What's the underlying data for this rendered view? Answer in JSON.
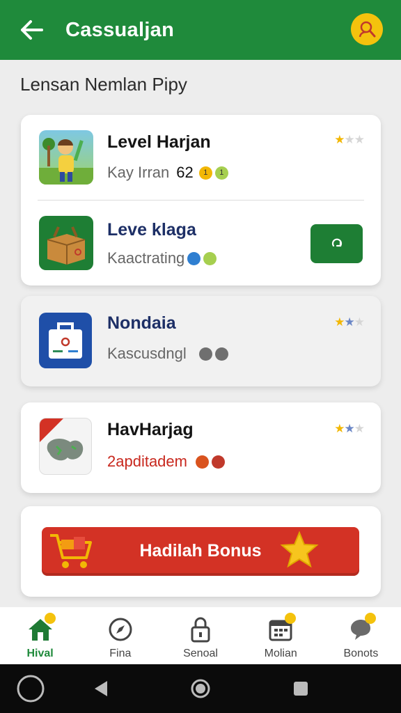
{
  "app_bar": {
    "title": "Cassualjan",
    "back_icon": "arrow-left-icon",
    "profile_icon": "user-icon"
  },
  "section_title": "Lensan Nemlan Pipy",
  "cards": [
    {
      "items": [
        {
          "name": "Level Harjan",
          "subtitle": "Kay Irran",
          "score": "62",
          "badges": [
            "1",
            "1"
          ],
          "rating": 1
        },
        {
          "name": "Leve klaga",
          "subtitle": "Kaactrating",
          "badges": [
            "",
            ""
          ],
          "action_icon": "refresh-icon"
        }
      ]
    },
    {
      "items": [
        {
          "name": "Nondaia",
          "subtitle": "Kascusdngl",
          "rating": 2
        }
      ]
    },
    {
      "items": [
        {
          "name": "HavHarjag",
          "subtitle": "2apditadem",
          "badges": [
            "",
            ""
          ],
          "rating": 2
        }
      ]
    }
  ],
  "bonus": {
    "label": "Hadilah Bonus",
    "left_icon": "shopping-cart-icon",
    "right_icon": "star-icon"
  },
  "bottom_nav": [
    {
      "label": "Hival",
      "icon": "home-icon",
      "active": true
    },
    {
      "label": "Fina",
      "icon": "compass-icon"
    },
    {
      "label": "Senoal",
      "icon": "lock-icon"
    },
    {
      "label": "Molian",
      "icon": "calendar-icon"
    },
    {
      "label": "Bonots",
      "icon": "chat-icon"
    }
  ],
  "colors": {
    "primary": "#1f8a3b",
    "accent": "#f4c20d",
    "bonus": "#d33225"
  }
}
